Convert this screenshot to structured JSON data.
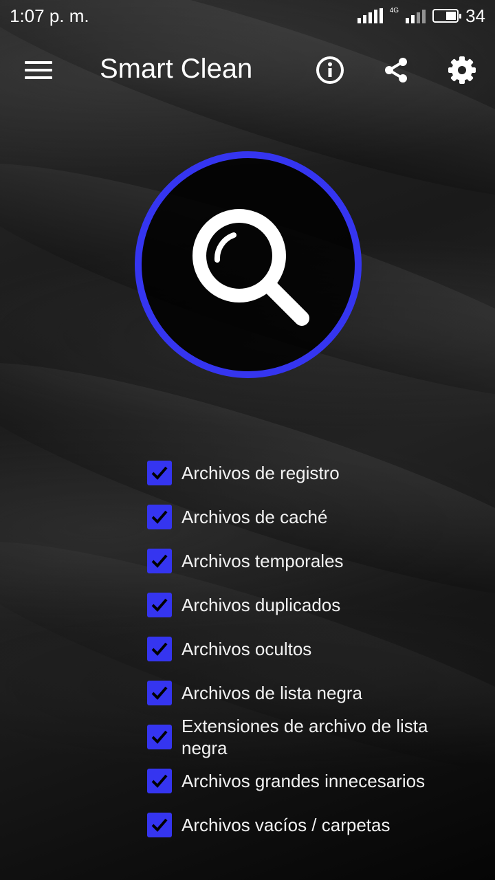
{
  "status_bar": {
    "time": "1:07 p. m.",
    "network": "4G",
    "battery": "34"
  },
  "app_bar": {
    "title": "Smart Clean",
    "icons": [
      "menu-icon",
      "info-icon",
      "share-icon",
      "settings-icon"
    ]
  },
  "scan": {
    "icon": "search-icon",
    "ring_color": "#3535f0"
  },
  "options": [
    {
      "label": "Archivos de registro",
      "checked": true
    },
    {
      "label": "Archivos de caché",
      "checked": true
    },
    {
      "label": "Archivos temporales",
      "checked": true
    },
    {
      "label": "Archivos duplicados",
      "checked": true
    },
    {
      "label": "Archivos ocultos",
      "checked": true
    },
    {
      "label": "Archivos de lista negra",
      "checked": true
    },
    {
      "label": "Extensiones de archivo de lista negra",
      "checked": true
    },
    {
      "label": "Archivos grandes innecesarios",
      "checked": true
    },
    {
      "label": "Archivos vacíos / carpetas",
      "checked": true
    }
  ],
  "accent_color": "#3535f0"
}
